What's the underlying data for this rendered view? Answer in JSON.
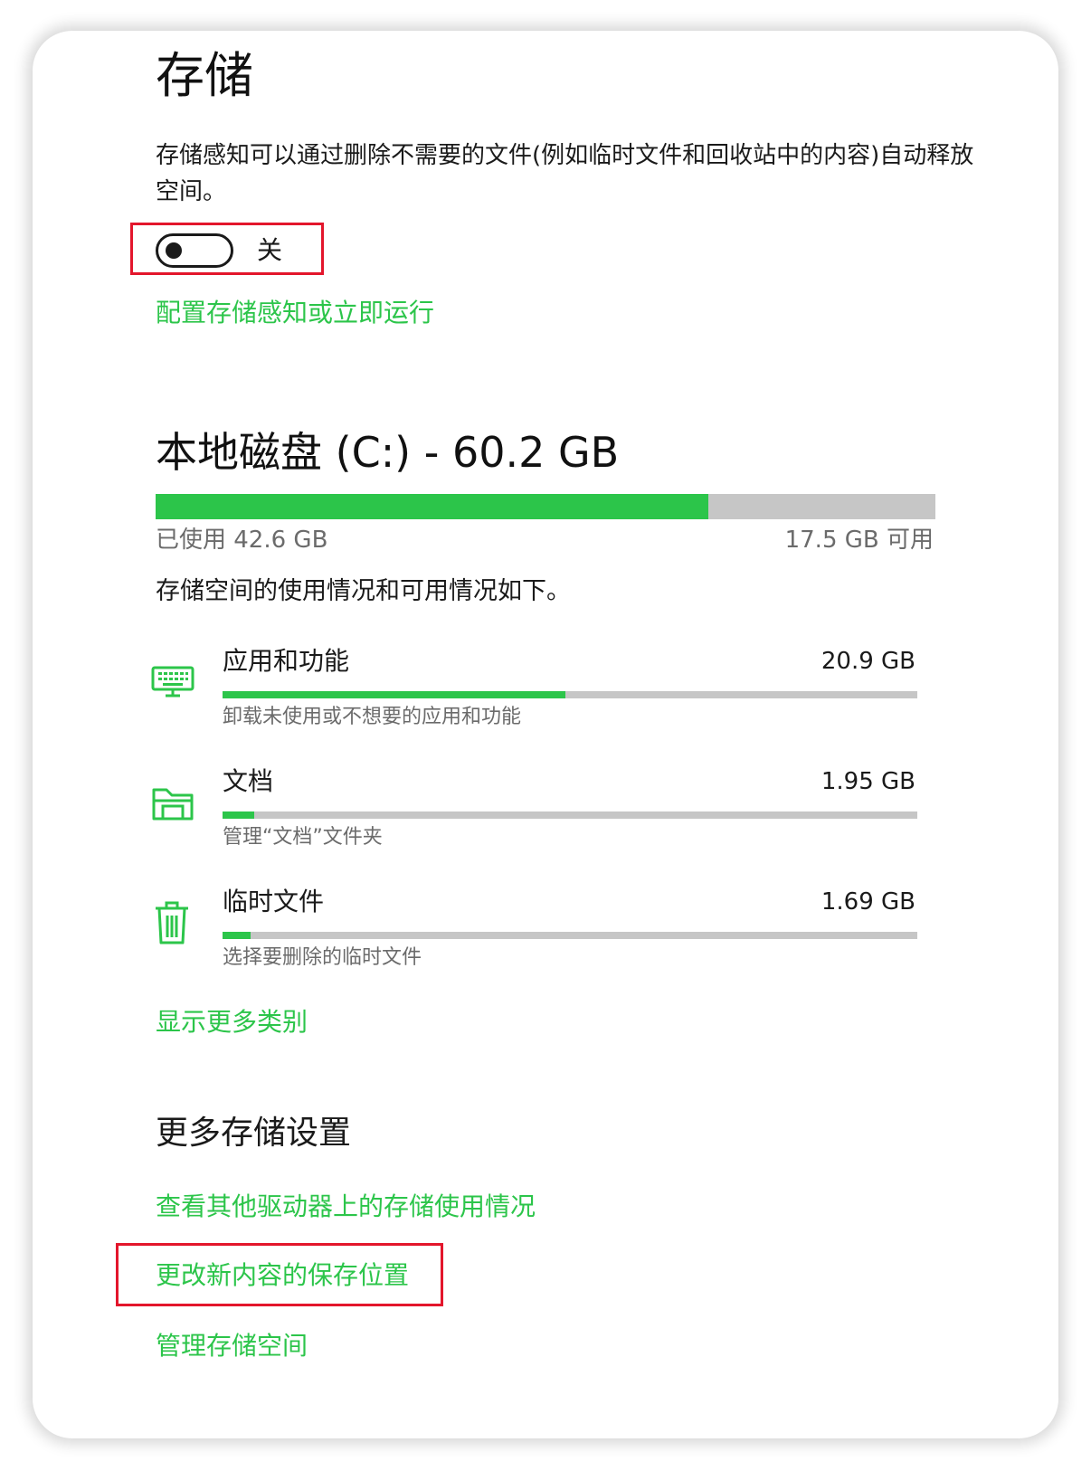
{
  "page": {
    "title": "存储"
  },
  "storage_sense": {
    "description": "存储感知可以通过删除不需要的文件(例如临时文件和回收站中的内容)自动释放空间。",
    "toggle_state": "关",
    "toggle_on": false,
    "configure_link": "配置存储感知或立即运行"
  },
  "drive": {
    "title": "本地磁盘 (C:) - 60.2 GB",
    "used_fraction": 0.709,
    "used_label": "已使用 42.6 GB",
    "free_label": "17.5 GB 可用",
    "summary": "存储空间的使用情况和可用情况如下。"
  },
  "categories": [
    {
      "icon": "keyboard-icon",
      "name": "应用和功能",
      "size": "20.9 GB",
      "fraction": 0.493,
      "desc": "卸载未使用或不想要的应用和功能"
    },
    {
      "icon": "folder-icon",
      "name": "文档",
      "size": "1.95 GB",
      "fraction": 0.046,
      "desc": "管理“文档”文件夹"
    },
    {
      "icon": "trash-icon",
      "name": "临时文件",
      "size": "1.69 GB",
      "fraction": 0.04,
      "desc": "选择要删除的临时文件"
    }
  ],
  "show_more_link": "显示更多类别",
  "more_settings": {
    "title": "更多存储设置",
    "links": [
      "查看其他驱动器上的存储使用情况",
      "更改新内容的保存位置",
      "管理存储空间"
    ]
  },
  "colors": {
    "accent": "#2cc54a",
    "highlight": "#e3162c",
    "track": "#c6c6c6"
  }
}
